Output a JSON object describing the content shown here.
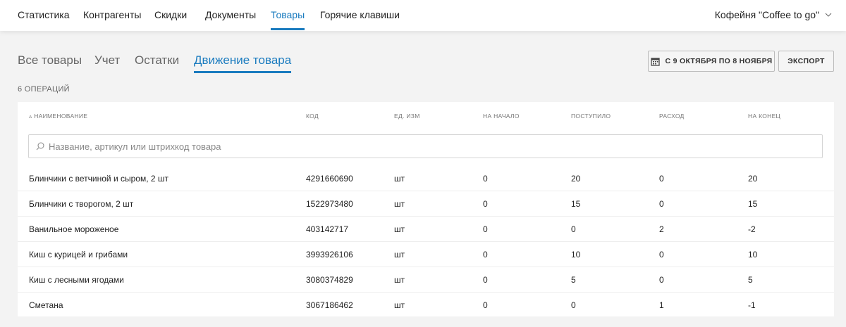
{
  "nav": {
    "items": [
      "Статистика",
      "Контрагенты",
      "Скидки",
      "Документы",
      "Товары",
      "Горячие клавиши"
    ],
    "active": 4
  },
  "store": {
    "label": "Кофейня \"Coffee to go\"",
    "icon": "chevron-down-icon"
  },
  "subtabs": {
    "items": [
      "Все товары",
      "Учет",
      "Остатки",
      "Движение товара"
    ],
    "active": 3
  },
  "toolbar": {
    "date_range": "С 9 ОКТЯБРЯ ПО 8 НОЯБРЯ",
    "export": "ЭКСПОРТ"
  },
  "count": "6 ОПЕРАЦИЙ",
  "table": {
    "headers": [
      "НАИМЕНОВАНИЕ",
      "КОД",
      "ЕД. ИЗМ",
      "НА НАЧАЛО",
      "ПОСТУПИЛО",
      "РАСХОД",
      "НА КОНЕЦ"
    ],
    "search_placeholder": "Название, артикул или штрихкод товара",
    "rows": [
      [
        "Блинчики с ветчиной и сыром, 2 шт",
        "4291660690",
        "шт",
        "0",
        "20",
        "0",
        "20"
      ],
      [
        "Блинчики с творогом, 2 шт",
        "1522973480",
        "шт",
        "0",
        "15",
        "0",
        "15"
      ],
      [
        "Ванильное мороженое",
        "403142717",
        "шт",
        "0",
        "0",
        "2",
        "-2"
      ],
      [
        "Киш с курицей и грибами",
        "3993926106",
        "шт",
        "0",
        "10",
        "0",
        "10"
      ],
      [
        "Киш с лесными ягодами",
        "3080374829",
        "шт",
        "0",
        "5",
        "0",
        "5"
      ],
      [
        "Сметана",
        "3067186462",
        "шт",
        "0",
        "0",
        "1",
        "-1"
      ]
    ]
  },
  "colors": {
    "accent": "#1a7bbf"
  }
}
